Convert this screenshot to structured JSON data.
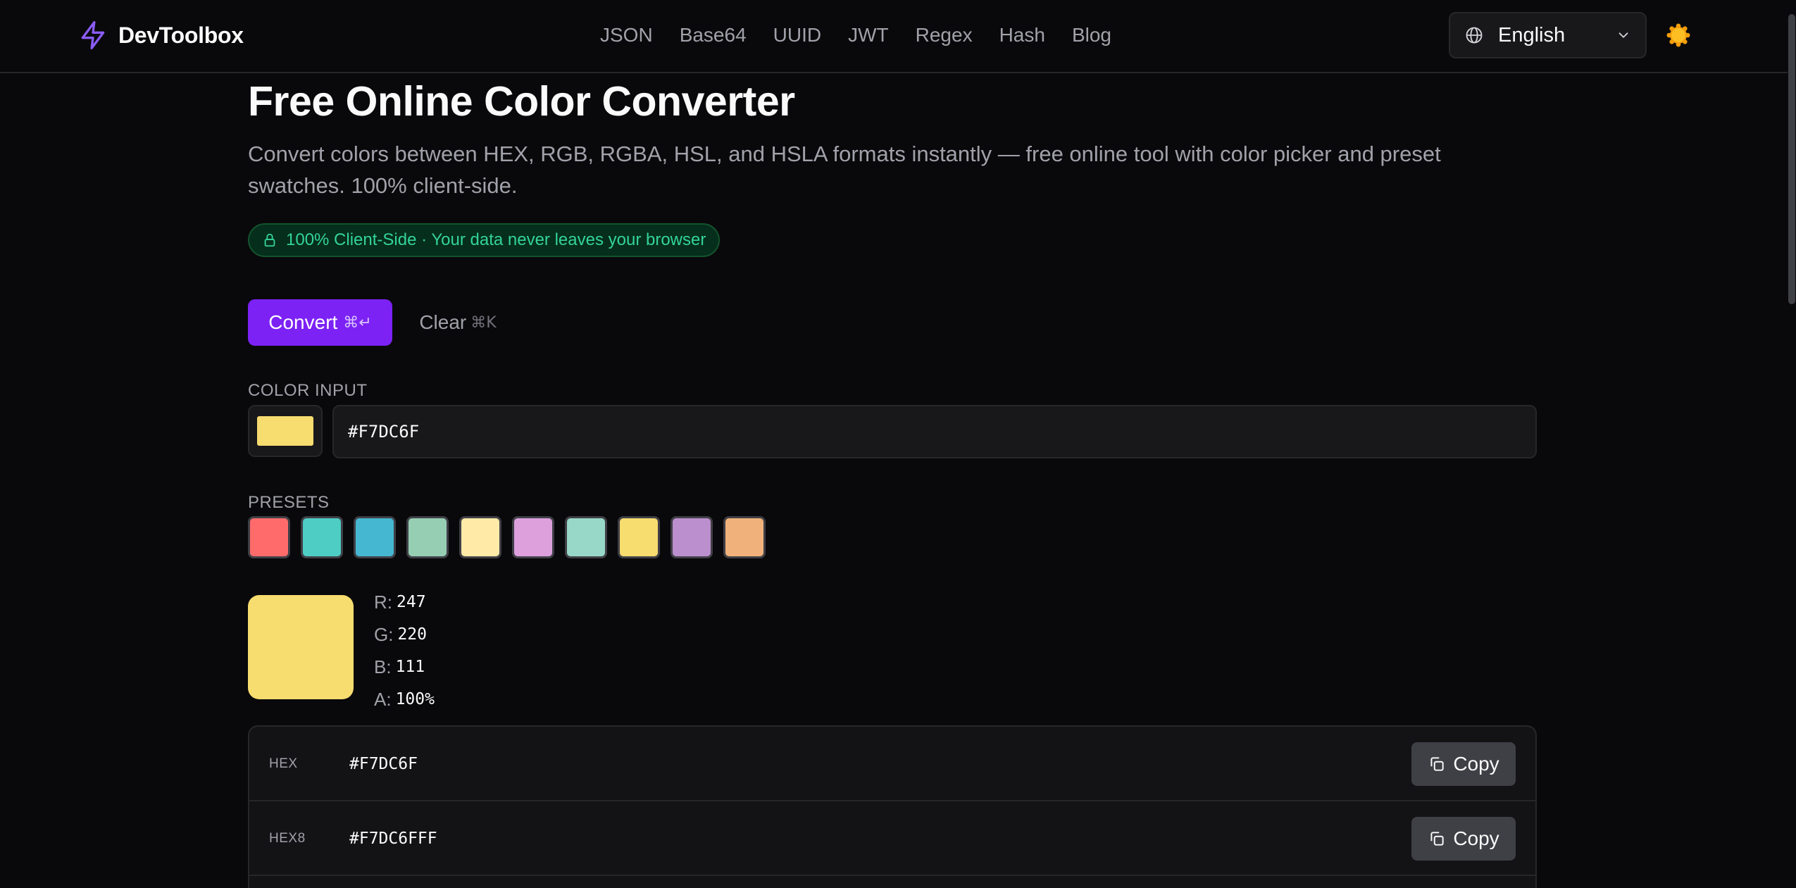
{
  "navbar": {
    "brand": "DevToolbox",
    "brand_icon": "lightning-icon",
    "links": [
      "JSON",
      "Base64",
      "UUID",
      "JWT",
      "Regex",
      "Hash",
      "Blog"
    ],
    "language": "English",
    "theme_icon": "sun-icon"
  },
  "main": {
    "title": "Free Online Color Converter",
    "description": "Convert colors between HEX, RGB, RGBA, HSL, and HSLA formats instantly — free online tool with color picker and preset swatches. 100% client-side.",
    "privacy_badge": "100% Client-Side · Your data never leaves your browser",
    "convert_label": "Convert",
    "convert_shortcut": "⌘↵",
    "clear_label": "Clear",
    "clear_shortcut": "⌘K",
    "color_input_label": "COLOR INPUT",
    "color_input_value": "#F7DC6F",
    "presets_label": "PRESETS",
    "presets": [
      "#FF6B6B",
      "#4ECDC4",
      "#45B7D1",
      "#96CEB4",
      "#FFEAA7",
      "#DDA0DD",
      "#98D8C8",
      "#F7DC6F",
      "#BB8FCE",
      "#F0B27A"
    ],
    "preview_color": "#F7DC6F",
    "channels": [
      {
        "key": "R:",
        "value": "247"
      },
      {
        "key": "G:",
        "value": "220"
      },
      {
        "key": "B:",
        "value": "111"
      },
      {
        "key": "A:",
        "value": "100%"
      }
    ],
    "formats": [
      {
        "label": "HEX",
        "value": "#F7DC6F",
        "copy_label": "Copy"
      },
      {
        "label": "HEX8",
        "value": "#F7DC6FFF",
        "copy_label": "Copy"
      }
    ]
  },
  "colors": {
    "background": "#09090b",
    "accent": "#7c22f5",
    "badge_text": "#34d399"
  }
}
